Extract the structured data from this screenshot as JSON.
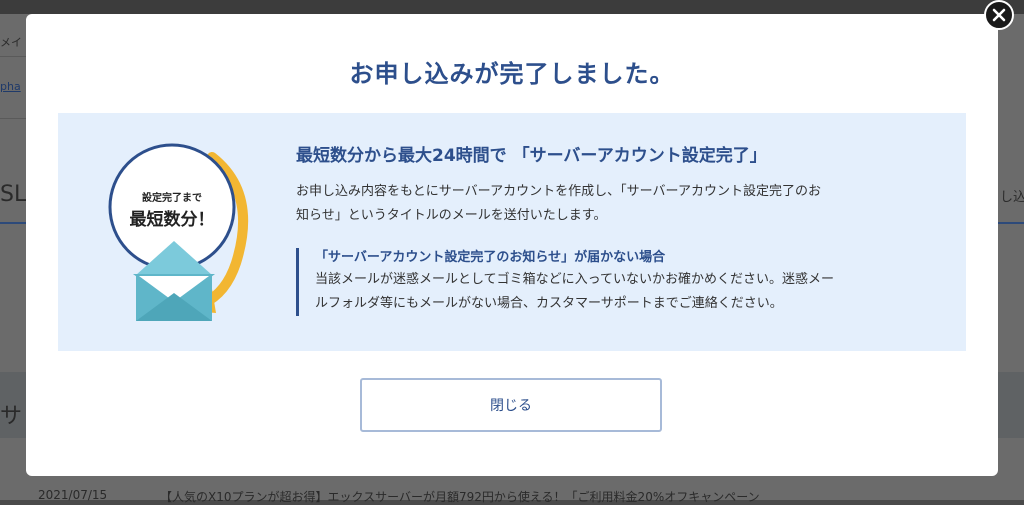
{
  "background": {
    "nav_fragment": "メイ",
    "link_fragment": "pha",
    "heading_fragment": "SL",
    "tab_fragment": "し込",
    "section_fragment": "サ",
    "news_date": "2021/07/15",
    "news_text": "【人気のX10プランが超お得】エックスサーバーが月額792円から使える！「ご利用料金20%オフキャンペーン"
  },
  "modal": {
    "title": "お申し込みが完了しました。",
    "illustration": {
      "badge_line1": "設定完了まで",
      "badge_line2": "最短数分！"
    },
    "heading": "最短数分から最大24時間で 「サーバーアカウント設定完了」",
    "body_lines": [
      "お申し込み内容をもとにサーバーアカウントを作成し、「サーバーアカウント設定完了のお",
      "知らせ」というタイトルのメールを送付いたします。"
    ],
    "note": {
      "title": "「サーバーアカウント設定完了のお知らせ」が届かない場合",
      "lines": [
        "当該メールが迷惑メールとしてゴミ箱などに入っていないかお確かめください。迷惑メー",
        "ルフォルダ等にもメールがない場合、カスタマーサポートまでご連絡ください。"
      ]
    },
    "close_button_label": "閉じる"
  },
  "colors": {
    "accent": "#2d4f8c",
    "info_bg": "#e4effc",
    "envelope": "#5fb6c9",
    "arrow": "#f2b632"
  },
  "icons": {
    "close": "close-icon",
    "envelope": "envelope-icon",
    "arrow": "curved-arrow-icon"
  }
}
